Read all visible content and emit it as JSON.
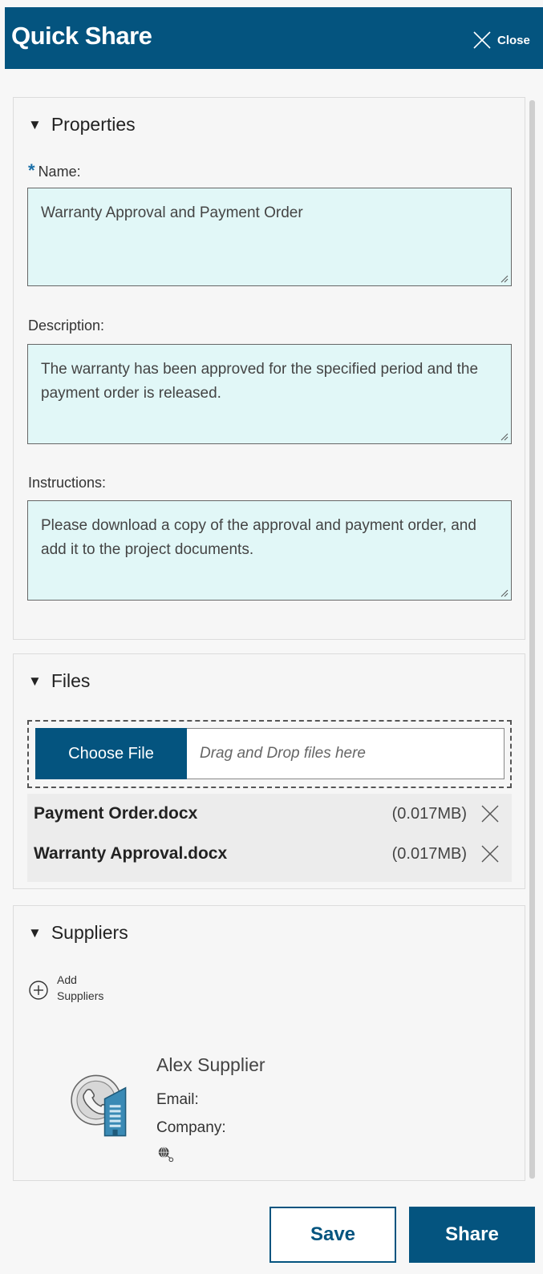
{
  "header": {
    "title": "Quick Share",
    "close_label": "Close"
  },
  "properties": {
    "heading": "Properties",
    "name_label": "Name:",
    "name_value": "Warranty Approval and Payment Order",
    "description_label": "Description:",
    "description_value": "The warranty has been approved for the specified period and the payment order is released.",
    "instructions_label": "Instructions:",
    "instructions_value": "Please download a copy of the approval and payment order, and add it to the project documents."
  },
  "files": {
    "heading": "Files",
    "choose_label": "Choose File",
    "drop_placeholder": "Drag and Drop files here",
    "items": [
      {
        "name": "Payment Order.docx",
        "size": "(0.017MB)"
      },
      {
        "name": "Warranty Approval.docx",
        "size": "(0.017MB)"
      }
    ]
  },
  "suppliers": {
    "heading": "Suppliers",
    "add_label_line1": "Add",
    "add_label_line2": "Suppliers",
    "items": [
      {
        "name": "Alex Supplier",
        "email_label": "Email:",
        "company_label": "Company:"
      }
    ]
  },
  "footer": {
    "save_label": "Save",
    "share_label": "Share"
  },
  "colors": {
    "brand": "#04547f",
    "field_bg": "#e1f7f7"
  }
}
